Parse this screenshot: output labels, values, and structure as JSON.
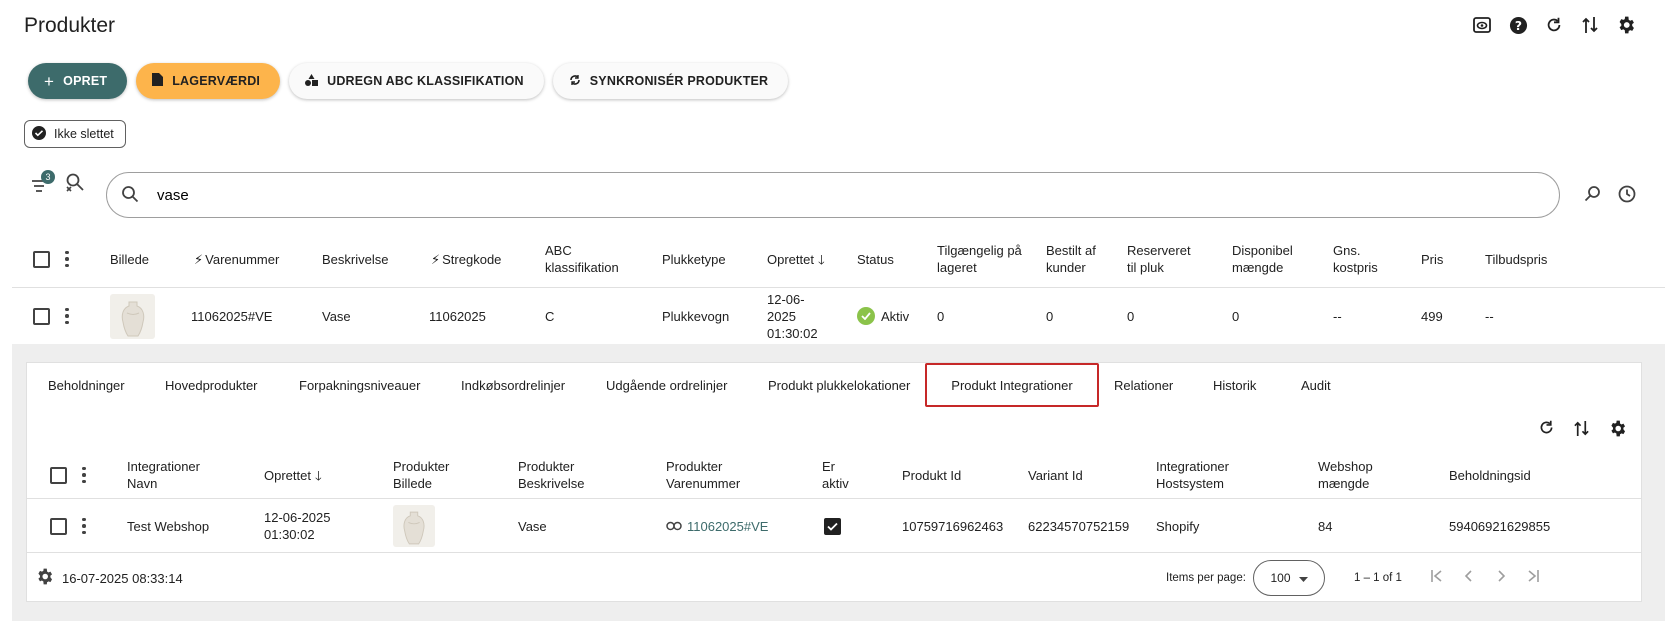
{
  "page": {
    "title": "Produkter"
  },
  "toolbar_icons": [
    "preview-icon",
    "help-icon",
    "refresh-icon",
    "sort-icon",
    "settings-icon"
  ],
  "actions": {
    "create": "OPRET",
    "stock_value": "LAGERVÆRDI",
    "abc": "UDREGN ABC KLASSIFIKATION",
    "sync": "SYNKRONISÉR PRODUKTER"
  },
  "filter_chip": "Ikke slettet",
  "filter_count": "3",
  "search": {
    "value": "vase"
  },
  "table": {
    "columns": [
      "Billede",
      "Varenummer",
      "Beskrivelse",
      "Stregkode",
      "ABC klassifikation",
      "Plukketype",
      "Oprettet",
      "Status",
      "Tilgængelig på lageret",
      "Bestilt af kunder",
      "Reserveret til pluk",
      "Disponibel mængde",
      "Gns. kostpris",
      "Pris",
      "Tilbudspris"
    ],
    "row": {
      "varenummer": "11062025#VE",
      "beskrivelse": "Vase",
      "stregkode": "11062025",
      "abc": "C",
      "plukketype": "Plukkevogn",
      "oprettet": "12-06-2025 01:30:02",
      "status": "Aktiv",
      "tilgaengelig": "0",
      "bestilt": "0",
      "reserveret": "0",
      "disponibel": "0",
      "kostpris": "--",
      "pris": "499",
      "tilbudspris": "--"
    }
  },
  "detail": {
    "tabs": [
      "Beholdninger",
      "Hovedprodukter",
      "Forpakningsniveauer",
      "Indkøbsordrelinjer",
      "Udgående ordrelinjer",
      "Produkt plukkelokationer",
      "Produkt Integrationer",
      "Relationer",
      "Historik",
      "Audit"
    ],
    "active_tab": "Produkt Integrationer",
    "columns": [
      "Integrationer Navn",
      "Oprettet",
      "Produkter Billede",
      "Produkter Beskrivelse",
      "Produkter Varenummer",
      "Er aktiv",
      "Produkt Id",
      "Variant Id",
      "Integrationer Hostsystem",
      "Webshop mængde",
      "Beholdningsid"
    ],
    "row": {
      "navn": "Test Webshop",
      "oprettet": "12-06-2025 01:30:02",
      "beskrivelse": "Vase",
      "varenummer": "11062025#VE",
      "er_aktiv": true,
      "produkt_id": "10759716962463",
      "variant_id": "62234570752159",
      "hostsystem": "Shopify",
      "webshop_maengde": "84",
      "beholdningsid": "59406921629855"
    },
    "footer": {
      "timestamp": "16-07-2025 08:33:14",
      "items_per_page_label": "Items per page:",
      "items_per_page": "100",
      "range": "1 – 1 of 1"
    }
  },
  "colors": {
    "teal": "#3d6b6b",
    "orange": "#fdb44b",
    "active_tab_border": "#c62828",
    "status_green": "#8bc34a"
  }
}
